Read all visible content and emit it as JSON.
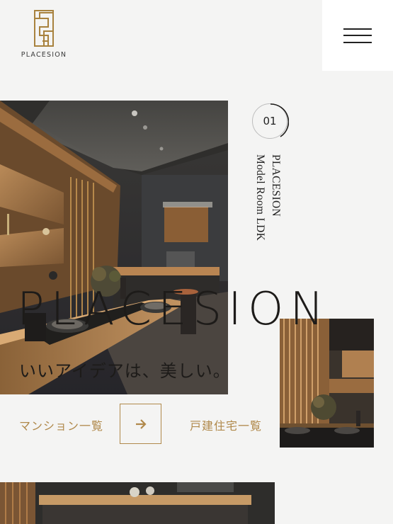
{
  "header": {
    "brand_text": "PLACESION",
    "logo_color": "#a8823e"
  },
  "menu": {
    "icon": "hamburger-menu-icon"
  },
  "slide": {
    "number": "01",
    "title_line1": "PLACESION",
    "title_line2": "Model Room LDK"
  },
  "hero": {
    "brand_text": "PLACESION",
    "tagline": "いいアイデアは、美しい。"
  },
  "links": {
    "mansion_label": "マンション一覧",
    "house_label": "戸建住宅一覧",
    "arrow_icon": "arrow-right-icon",
    "accent_color": "#b0894b"
  }
}
